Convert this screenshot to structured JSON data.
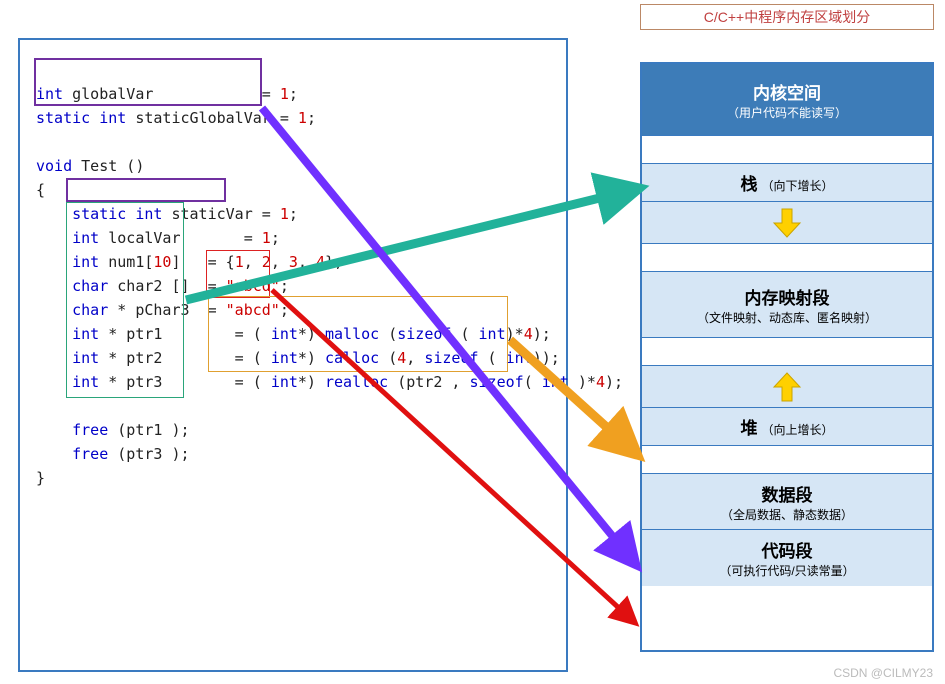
{
  "title": "C/C++中程序内存区域划分",
  "code": {
    "globalDecl1": "int globalVar            = 1;",
    "globalDecl2": "static int staticGlobalVar = 1;",
    "fnSig": "void Test ()",
    "braceOpen": "{",
    "staticVar": "static int staticVar = 1;",
    "localVar": "int localVar       = 1;",
    "num1": "int num1[10]   = {1, 2, 3, 4};",
    "char2": "char char2 []  = \"abcd\";",
    "pChar3": "char * pChar3  = \"abcd\";",
    "ptr1": "int * ptr1        = ( int*) malloc (sizeof ( int)*4);",
    "ptr2": "int * ptr2        = ( int*) calloc (4, sizeof ( int));",
    "ptr3": "int * ptr3        = ( int*) realloc (ptr2 , sizeof( int )*4);",
    "free1": "free (ptr1 );",
    "free3": "free (ptr3 );",
    "braceClose": "}"
  },
  "memory": {
    "kernel": {
      "maj": "内核空间",
      "min": "（用户代码不能读写）"
    },
    "stack": {
      "maj": "栈",
      "min": "（向下增长）"
    },
    "mmap": {
      "maj": "内存映射段",
      "min": "（文件映射、动态库、匿名映射）"
    },
    "heap": {
      "maj": "堆",
      "min": "（向上增长）"
    },
    "data": {
      "maj": "数据段",
      "min": "（全局数据、静态数据）"
    },
    "codeSeg": {
      "maj": "代码段",
      "min": "（可执行代码/只读常量）"
    }
  },
  "watermark": "CSDN @CILMY23",
  "chart_data": {
    "type": "table",
    "title": "C/C++中程序内存区域划分",
    "segments_top_to_bottom": [
      {
        "name": "内核空间",
        "note": "用户代码不能读写"
      },
      {
        "name": "栈",
        "note": "向下增长"
      },
      {
        "name": "内存映射段",
        "note": "文件映射、动态库、匿名映射"
      },
      {
        "name": "堆",
        "note": "向上增长"
      },
      {
        "name": "数据段",
        "note": "全局数据、静态数据"
      },
      {
        "name": "代码段",
        "note": "可执行代码/只读常量"
      }
    ],
    "mappings": [
      {
        "source_box": "局部变量 localVar/num1/char2/pChar3/ptr1/ptr2/ptr3 (栈帧变量)",
        "target_segment": "栈",
        "arrow_color": "teal"
      },
      {
        "source_box": "malloc / calloc / realloc 返回的内存块",
        "target_segment": "堆",
        "arrow_color": "orange"
      },
      {
        "source_box": "globalVar / staticGlobalVar / staticVar (全局及静态变量)",
        "target_segment": "数据段",
        "arrow_color": "purple"
      },
      {
        "source_box": "\"abcd\" 字符串字面量",
        "target_segment": "代码段",
        "arrow_color": "red"
      }
    ]
  }
}
